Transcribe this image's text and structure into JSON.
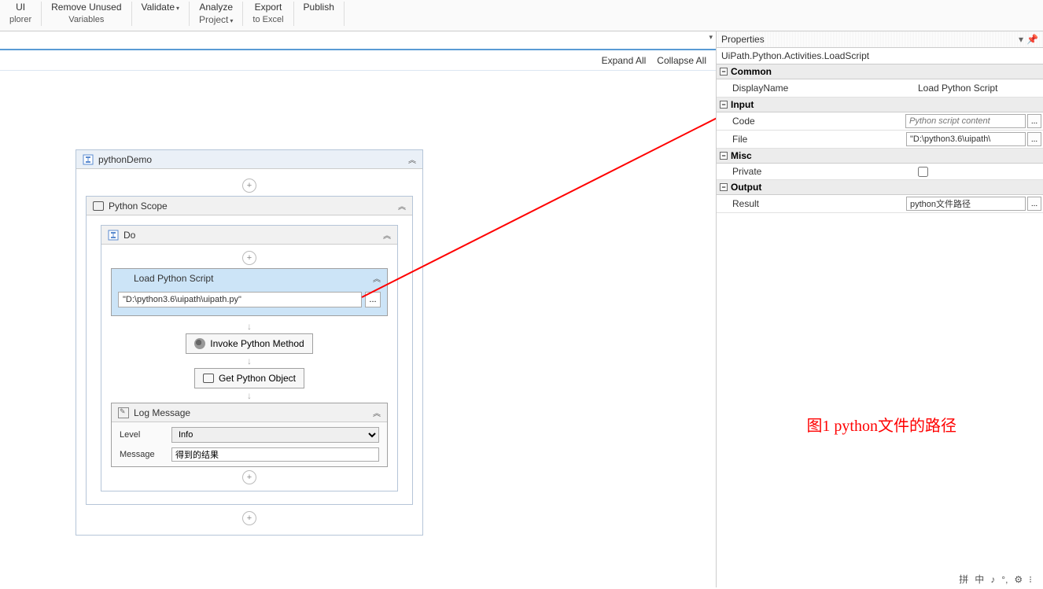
{
  "toolbar": {
    "items": [
      {
        "line1": "UI",
        "line2": "plorer"
      },
      {
        "line1": "Remove Unused",
        "line2": "Variables"
      },
      {
        "line1": "Validate",
        "line2": ""
      },
      {
        "line1": "Analyze",
        "line2": "Project"
      },
      {
        "line1": "Export",
        "line2": "to Excel"
      },
      {
        "line1": "Publish",
        "line2": ""
      }
    ]
  },
  "designer": {
    "expand_all": "Expand All",
    "collapse_all": "Collapse All"
  },
  "workflow": {
    "root_title": "pythonDemo",
    "scope_title": "Python Scope",
    "do_title": "Do",
    "load_script": {
      "title": "Load Python Script",
      "path": "\"D:\\python3.6\\uipath\\uipath.py\"",
      "browse": "..."
    },
    "invoke_title": "Invoke Python Method",
    "getobj_title": "Get Python Object",
    "log": {
      "title": "Log Message",
      "level_label": "Level",
      "level_value": "Info",
      "msg_label": "Message",
      "msg_value": "得到的结果"
    }
  },
  "properties": {
    "panel_title": "Properties",
    "activity_type": "UiPath.Python.Activities.LoadScript",
    "categories": {
      "common": "Common",
      "input": "Input",
      "misc": "Misc",
      "output": "Output"
    },
    "rows": {
      "displayname_label": "DisplayName",
      "displayname_value": "Load Python Script",
      "code_label": "Code",
      "code_placeholder": "Python script content",
      "file_label": "File",
      "file_value": "\"D:\\python3.6\\uipath\\",
      "private_label": "Private",
      "result_label": "Result",
      "result_value": "python文件路径"
    },
    "browse": "..."
  },
  "annotation": "图1 python文件的路径",
  "statusbar": {
    "items": [
      "拼",
      "中",
      "♪",
      "°,",
      "⚙",
      "⁝"
    ]
  }
}
